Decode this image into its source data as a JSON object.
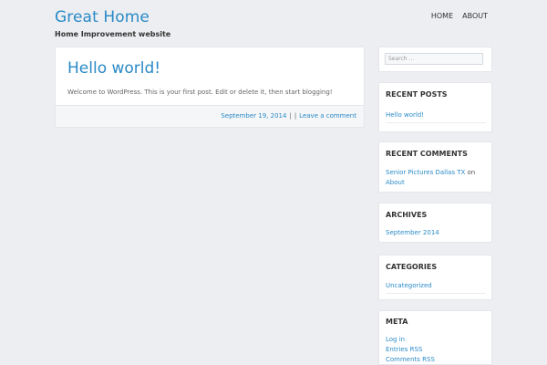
{
  "header": {
    "site_title": "Great Home",
    "site_description": "Home Improvement website",
    "nav": [
      "HOME",
      "ABOUT"
    ]
  },
  "post": {
    "title": "Hello world!",
    "content": "Welcome to WordPress. This is your first post. Edit or delete it, then start blogging!",
    "date": "September 19, 2014",
    "sep": "|",
    "sep2": "|",
    "comments": "Leave a comment"
  },
  "sidebar": {
    "search_placeholder": "Search ...",
    "recent_posts": {
      "title": "RECENT POSTS",
      "items": [
        "Hello world!"
      ]
    },
    "recent_comments": {
      "title": "RECENT COMMENTS",
      "author": "Senior Pictures Dallas TX",
      "on": "on",
      "post": "About"
    },
    "archives": {
      "title": "ARCHIVES",
      "items": [
        "September 2014"
      ]
    },
    "categories": {
      "title": "CATEGORIES",
      "items": [
        "Uncategorized"
      ]
    },
    "meta": {
      "title": "META",
      "items": [
        "Log in",
        "Entries RSS",
        "Comments RSS"
      ]
    }
  }
}
